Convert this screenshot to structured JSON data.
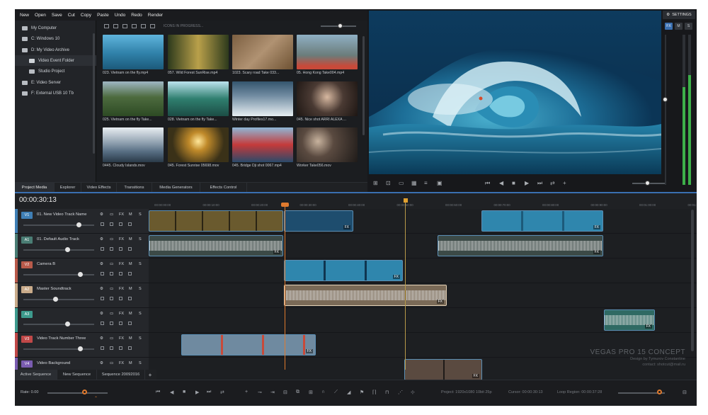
{
  "menu": [
    "New",
    "Open",
    "Save",
    "Cut",
    "Copy",
    "Paste",
    "Undo",
    "Redo",
    "Render"
  ],
  "explorer": {
    "tree": [
      {
        "label": "My Computer",
        "icon": "computer-icon"
      },
      {
        "label": "C: Windows 10",
        "icon": "drive-icon"
      },
      {
        "label": "D: My Video Archive",
        "icon": "drive-icon"
      },
      {
        "label": "Video Event Folder",
        "icon": "folder-icon",
        "selected": true
      },
      {
        "label": "Studio Project",
        "icon": "folder-icon"
      },
      {
        "label": "E: Video Server",
        "icon": "drive-icon"
      },
      {
        "label": "F: External USB 10 Tb",
        "icon": "drive-icon"
      }
    ],
    "view_mode": "ICONS IN PROGRESS...",
    "media": [
      {
        "caption": "023. Vietnam on the fly.mp4",
        "color": "#2f80a8"
      },
      {
        "caption": "057. Wild Forest SunRise.mp4",
        "color": "#5b6a3a"
      },
      {
        "caption": "1023. Scary road Take 033...",
        "color": "#8a6b4a"
      },
      {
        "caption": "05. Hong Kong Take004.mp4",
        "color": "#6b7c7a"
      },
      {
        "caption": "025. Vietnam on the fly Take...",
        "color": "#4d6b3e"
      },
      {
        "caption": "028. Vietnam on the fly Take...",
        "color": "#2f7f6f"
      },
      {
        "caption": "Winter day Profiles17.mo...",
        "color": "#6f8aa0"
      },
      {
        "caption": "045. Nice shot ARRI ALEXA ...",
        "color": "#4a3a33"
      },
      {
        "caption": "0445. Cloudy Islands.mov",
        "color": "#566d82"
      },
      {
        "caption": "045. Forest Sunrise 05698.mov",
        "color": "#6a5a2e"
      },
      {
        "caption": "045. Bridge Dji shot 0067.mp4",
        "color": "#8a3a3a"
      },
      {
        "caption": "Worker Take056.mov",
        "color": "#3b3430"
      }
    ]
  },
  "panel_tabs": [
    "Project Media",
    "Explorer",
    "Video Effects",
    "Transitions",
    "Media Generators",
    "Effects Control"
  ],
  "preview": {
    "settings_label": "SETTINGS",
    "toggles": [
      "FX",
      "M",
      "S"
    ],
    "accent": "#3a6fb0"
  },
  "timeline": {
    "timecode": "00:00:30:13",
    "ruler": [
      "00:00:00:00",
      "00:00:10:00",
      "00:00:20:00",
      "00:00:30:00",
      "00:00:40:00",
      "00:00:50:00",
      "00:00:60:00",
      "00:00:70:00",
      "00:00:80:00",
      "00:00:90:00",
      "00:01:00:00",
      "00:01:10:00",
      "00:01:20:00"
    ],
    "buttons": [
      "FX",
      "M",
      "S"
    ],
    "tracks": [
      {
        "id": "V1",
        "name": "01. New Video Track Name",
        "color": "#3f7fb5",
        "vol": 0.78
      },
      {
        "id": "A1",
        "name": "01. Default Audio Track",
        "color": "#4a7d74",
        "vol": 0.62
      },
      {
        "id": "V2",
        "name": "Camera B",
        "color": "#b85a4a",
        "vol": 0.8
      },
      {
        "id": "A2",
        "name": "Master Soundtrack",
        "color": "#c9ab8a",
        "vol": 0.45
      },
      {
        "id": "A3",
        "name": "",
        "color": "#3d9a8d",
        "vol": 0.62
      },
      {
        "id": "V3",
        "name": "Video Track Number Three",
        "color": "#c04848",
        "vol": 0.8
      },
      {
        "id": "V4",
        "name": "Video Background",
        "color": "#7a5cb0",
        "vol": 0.82
      }
    ],
    "clip_fx": "FX",
    "sequences": [
      "Active Sequence",
      "New Sequence",
      "Sequence 20092016"
    ],
    "add_sequence": "+"
  },
  "status": {
    "rate": "Rate: 0.00",
    "project": "Project: 1920x1080 10bit 25p",
    "cursor": "Cursor: 00:00:30:13",
    "loop": "Loop Region: 00:00:37:28"
  },
  "watermark": {
    "title": "VEGAS PRO 15 CONCEPT",
    "line1": "Design by Tymurov Constantine",
    "line2": "contact: shotcut@mail.ru"
  }
}
